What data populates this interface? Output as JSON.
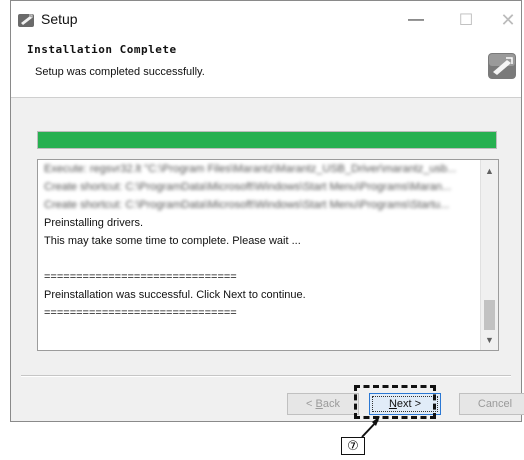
{
  "window": {
    "title": "Setup",
    "minimize_glyph": "—",
    "maximize_glyph": "☐",
    "close_glyph": "✕"
  },
  "header": {
    "title": "Installation Complete",
    "subtitle": "Setup was completed successfully."
  },
  "progress": {
    "percent": 100,
    "color": "#26b050"
  },
  "log": {
    "blurred_lines": [
      "Execute: regsvr32.lt \"C:\\Program Files\\Marantz\\Marantz_USB_Driver\\marantz_usb...",
      "Create shortcut: C:\\ProgramData\\Microsoft\\Windows\\Start Menu\\Programs\\Maran...",
      "Create shortcut: C:\\ProgramData\\Microsoft\\Windows\\Start Menu\\Programs\\Startu..."
    ],
    "lines": [
      "Preinstalling drivers.",
      "This may take some time to complete. Please wait ...",
      "",
      "==============================",
      "Preinstallation was successful. Click Next to continue.",
      "=============================="
    ],
    "scroll_up_glyph": "▲",
    "scroll_down_glyph": "▼"
  },
  "buttons": {
    "back_prefix": "< ",
    "back_underlined": "B",
    "back_rest": "ack",
    "next_underlined": "N",
    "next_rest": "ext >",
    "cancel": "Cancel"
  },
  "annotation": {
    "callout_number": "⑦"
  },
  "colors": {
    "accent": "#2b78d4",
    "progress": "#26b050"
  }
}
